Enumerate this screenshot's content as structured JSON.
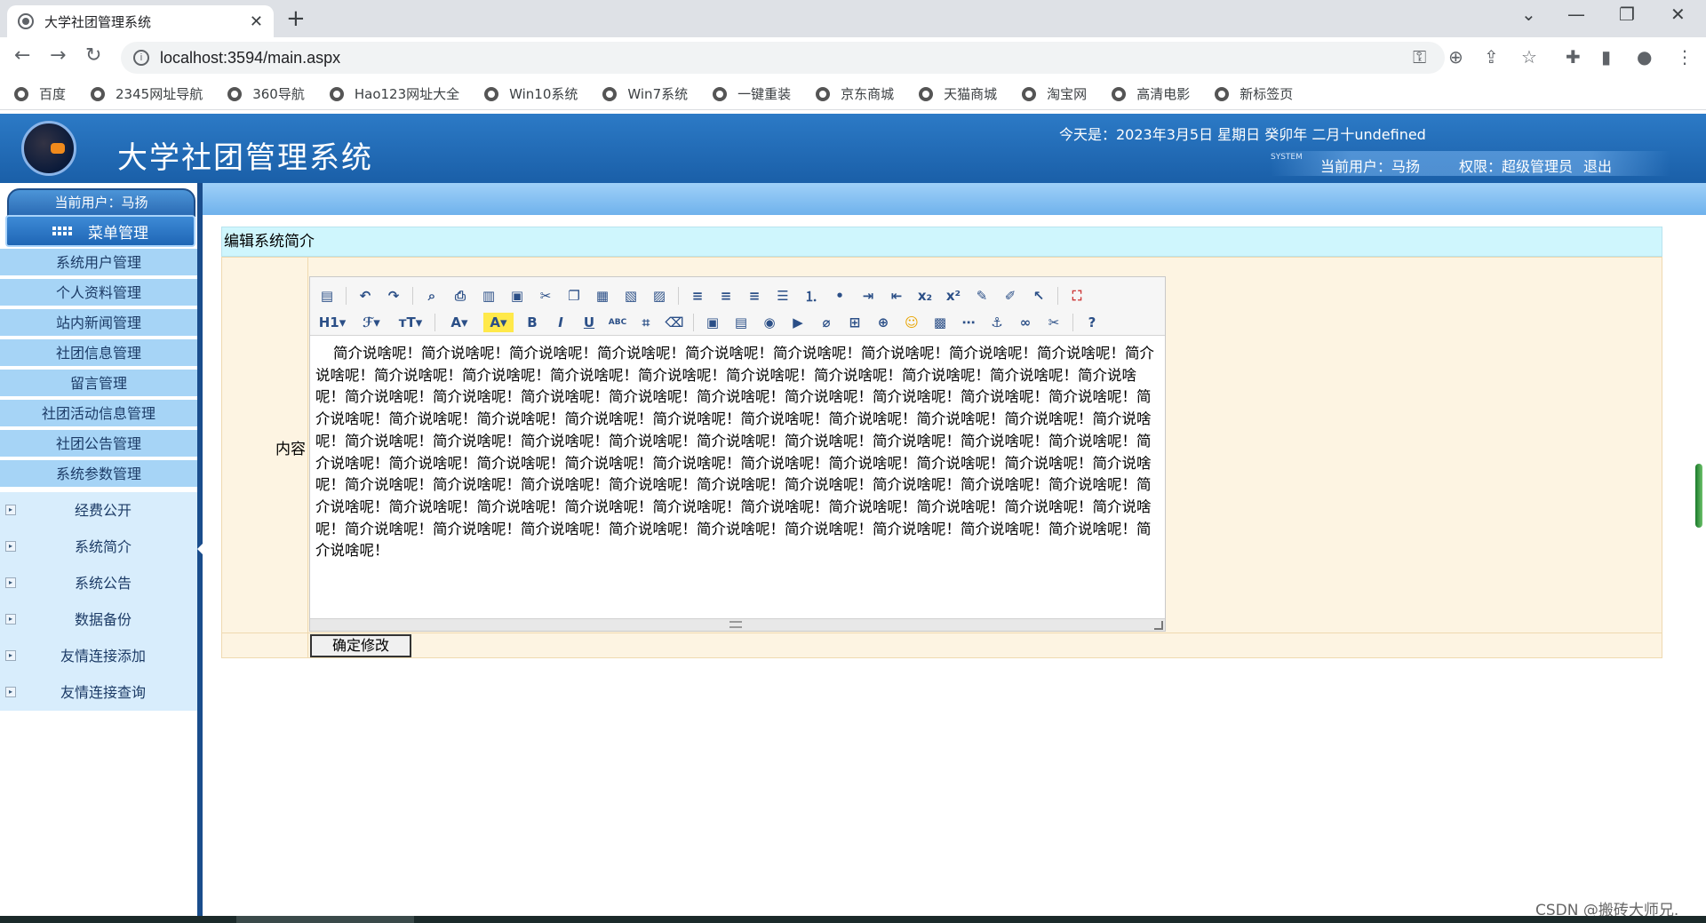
{
  "browser": {
    "tab_title": "大学社团管理系统",
    "tab_close": "✕",
    "new_tab": "+",
    "url": "localhost:3594/main.aspx",
    "bookmarks": [
      "百度",
      "2345网址导航",
      "360导航",
      "Hao123网址大全",
      "Win10系统",
      "Win7系统",
      "一键重装",
      "京东商城",
      "天猫商城",
      "淘宝网",
      "高清电影",
      "新标签页"
    ]
  },
  "header": {
    "title": "大学社团管理系统",
    "date_line": "今天是：2023年3月5日   星期日   癸卯年 二月十undefined",
    "system_tag": "SYSTEM",
    "current_user": "当前用户：马扬",
    "permission": "权限：超级管理员",
    "logout": "退出"
  },
  "sidebar": {
    "user_label": "当前用户：马扬",
    "menu_head": "菜单管理",
    "items": [
      "系统用户管理",
      "个人资料管理",
      "站内新闻管理",
      "社团信息管理",
      "留言管理",
      "社团活动信息管理",
      "社团公告管理",
      "系统参数管理"
    ],
    "subitems": [
      "经费公开",
      "系统简介",
      "系统公告",
      "数据备份",
      "友情连接添加",
      "友情连接查询"
    ]
  },
  "main": {
    "section_title": "编辑系统简介",
    "content_label": "内容",
    "editor_text": "简介说啥呢！简介说啥呢！简介说啥呢！简介说啥呢！简介说啥呢！简介说啥呢！简介说啥呢！简介说啥呢！简介说啥呢！简介说啥呢！简介说啥呢！简介说啥呢！简介说啥呢！简介说啥呢！简介说啥呢！简介说啥呢！简介说啥呢！简介说啥呢！简介说啥呢！简介说啥呢！简介说啥呢！简介说啥呢！简介说啥呢！简介说啥呢！简介说啥呢！简介说啥呢！简介说啥呢！简介说啥呢！简介说啥呢！简介说啥呢！简介说啥呢！简介说啥呢！简介说啥呢！简介说啥呢！简介说啥呢！简介说啥呢！简介说啥呢！简介说啥呢！简介说啥呢！简介说啥呢！简介说啥呢！简介说啥呢！简介说啥呢！简介说啥呢！简介说啥呢！简介说啥呢！简介说啥呢！简介说啥呢！简介说啥呢！简介说啥呢！简介说啥呢！简介说啥呢！简介说啥呢！简介说啥呢！简介说啥呢！简介说啥呢！简介说啥呢！简介说啥呢！简介说啥呢！简介说啥呢！简介说啥呢！简介说啥呢！简介说啥呢！简介说啥呢！简介说啥呢！简介说啥呢！简介说啥呢！简介说啥呢！简介说啥呢！简介说啥呢！简介说啥呢！简介说啥呢！简介说啥呢！简介说啥呢！简介说啥呢！简介说啥呢！简介说啥呢！简介说啥呢！简介说啥呢！简介说啥呢！简介说啥呢！简介说啥呢！简介说啥呢！简介说啥呢！简介说啥呢！简介说啥呢！",
    "toolbar": {
      "heading": "H1▾",
      "font_family": "ℱ▾",
      "font_size": "тT▾",
      "font_color": "A▾",
      "highlight": "A▾",
      "bold": "B",
      "italic": "I",
      "underline": "U",
      "strike": "ABC"
    },
    "confirm_button": "确定修改"
  },
  "watermark": "CSDN @搬砖大师兄."
}
